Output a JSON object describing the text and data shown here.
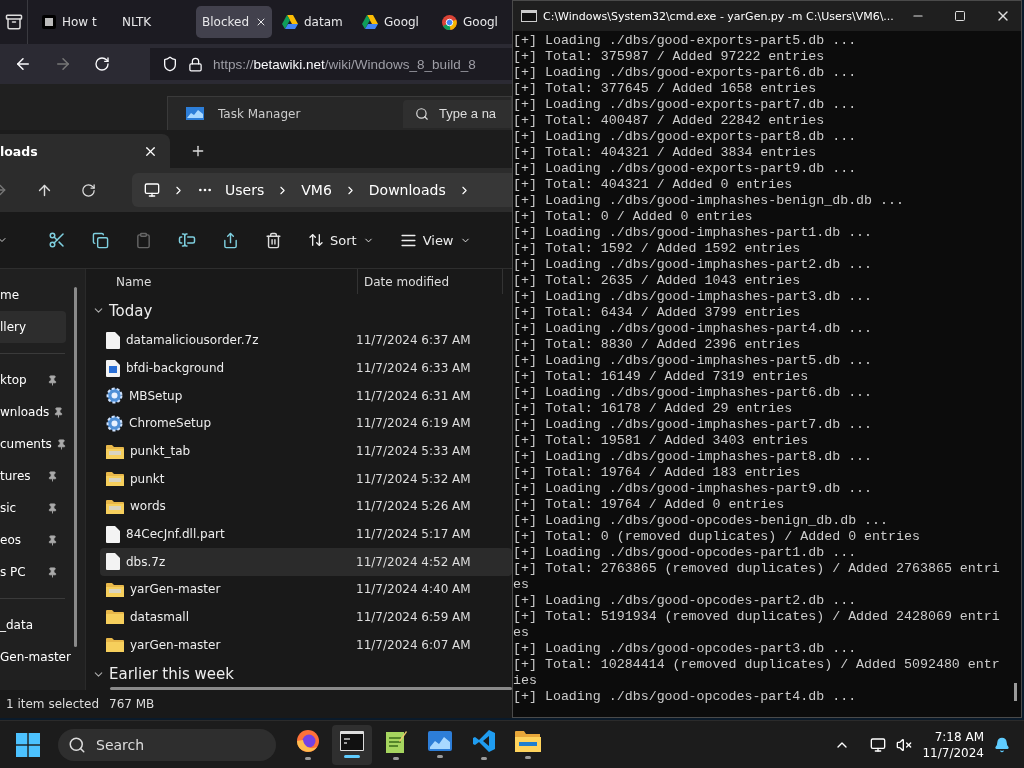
{
  "browser": {
    "tabs": [
      {
        "label": "How t",
        "kind": "mono",
        "selected": false
      },
      {
        "label": "NLTK",
        "kind": "plain",
        "selected": false
      },
      {
        "label": "Blocked",
        "kind": "plain",
        "selected": true
      },
      {
        "label": "datam",
        "kind": "drive",
        "selected": false
      },
      {
        "label": "Googl",
        "kind": "drive",
        "selected": false
      },
      {
        "label": "Googl",
        "kind": "chrome",
        "selected": false
      }
    ],
    "url": {
      "scheme": "https://",
      "host": "betawiki.net",
      "path": "/wiki/Windows_8_build_8"
    },
    "page": {
      "app_title": "Task Manager",
      "placeholder": "Type a na"
    }
  },
  "explorer": {
    "tab": {
      "label": "loads"
    },
    "breadcrumb": [
      "Users",
      "VM6",
      "Downloads"
    ],
    "toolbar": {
      "sort": "Sort",
      "view": "View"
    },
    "sidebar": {
      "sections": [
        {
          "items": [
            {
              "label": "me",
              "selected": false,
              "pinned": false
            },
            {
              "label": "llery",
              "selected": true,
              "pinned": false
            }
          ]
        },
        {
          "items": [
            {
              "label": "ktop",
              "selected": false,
              "pinned": true
            },
            {
              "label": "wnloads",
              "selected": false,
              "pinned": true
            },
            {
              "label": "cuments",
              "selected": false,
              "pinned": true
            },
            {
              "label": "tures",
              "selected": false,
              "pinned": true
            },
            {
              "label": "sic",
              "selected": false,
              "pinned": true
            },
            {
              "label": "eos",
              "selected": false,
              "pinned": true
            },
            {
              "label": "s PC",
              "selected": false,
              "pinned": true
            }
          ]
        },
        {
          "items": [
            {
              "label": "_data",
              "selected": false,
              "pinned": false
            },
            {
              "label": "Gen-master",
              "selected": false,
              "pinned": false
            }
          ]
        }
      ]
    },
    "columns": [
      "Name",
      "Date modified"
    ],
    "groups": [
      {
        "label": "Today",
        "expanded": true,
        "rows": [
          {
            "name": "datamaliciousorder.7z",
            "date": "11/7/2024 6:37 AM",
            "kind": "file",
            "selected": false
          },
          {
            "name": "bfdi-background",
            "date": "11/7/2024 6:33 AM",
            "kind": "image",
            "selected": false
          },
          {
            "name": "MBSetup",
            "date": "11/7/2024 6:31 AM",
            "kind": "installer",
            "selected": false
          },
          {
            "name": "ChromeSetup",
            "date": "11/7/2024 6:19 AM",
            "kind": "installer",
            "selected": false
          },
          {
            "name": "punkt_tab",
            "date": "11/7/2024 5:33 AM",
            "kind": "zip",
            "selected": false
          },
          {
            "name": "punkt",
            "date": "11/7/2024 5:32 AM",
            "kind": "zip",
            "selected": false
          },
          {
            "name": "words",
            "date": "11/7/2024 5:26 AM",
            "kind": "zip",
            "selected": false
          },
          {
            "name": "84CecJnf.dll.part",
            "date": "11/7/2024 5:17 AM",
            "kind": "file",
            "selected": false
          },
          {
            "name": "dbs.7z",
            "date": "11/7/2024 4:52 AM",
            "kind": "file",
            "selected": true
          },
          {
            "name": "yarGen-master",
            "date": "11/7/2024 4:40 AM",
            "kind": "zip",
            "selected": false
          },
          {
            "name": "datasmall",
            "date": "11/7/2024 6:59 AM",
            "kind": "folder",
            "selected": false
          },
          {
            "name": "yarGen-master",
            "date": "11/7/2024 6:07 AM",
            "kind": "folder",
            "selected": false
          }
        ]
      },
      {
        "label": "Earlier this week",
        "expanded": true
      }
    ],
    "status": {
      "selection": "1 item selected",
      "size": "767 MB"
    }
  },
  "console": {
    "title": "C:\\Windows\\System32\\cmd.exe - yarGen.py  -m C:\\Users\\VM6\\...",
    "lines": [
      "[+] Loading ./dbs/good-exports-part5.db ...",
      "[+] Total: 375987 / Added 97222 entries",
      "[+] Loading ./dbs/good-exports-part6.db ...",
      "[+] Total: 377645 / Added 1658 entries",
      "[+] Loading ./dbs/good-exports-part7.db ...",
      "[+] Total: 400487 / Added 22842 entries",
      "[+] Loading ./dbs/good-exports-part8.db ...",
      "[+] Total: 404321 / Added 3834 entries",
      "[+] Loading ./dbs/good-exports-part9.db ...",
      "[+] Total: 404321 / Added 0 entries",
      "[+] Loading ./dbs/good-imphashes-benign_db.db ...",
      "[+] Total: 0 / Added 0 entries",
      "[+] Loading ./dbs/good-imphashes-part1.db ...",
      "[+] Total: 1592 / Added 1592 entries",
      "[+] Loading ./dbs/good-imphashes-part2.db ...",
      "[+] Total: 2635 / Added 1043 entries",
      "[+] Loading ./dbs/good-imphashes-part3.db ...",
      "[+] Total: 6434 / Added 3799 entries",
      "[+] Loading ./dbs/good-imphashes-part4.db ...",
      "[+] Total: 8830 / Added 2396 entries",
      "[+] Loading ./dbs/good-imphashes-part5.db ...",
      "[+] Total: 16149 / Added 7319 entries",
      "[+] Loading ./dbs/good-imphashes-part6.db ...",
      "[+] Total: 16178 / Added 29 entries",
      "[+] Loading ./dbs/good-imphashes-part7.db ...",
      "[+] Total: 19581 / Added 3403 entries",
      "[+] Loading ./dbs/good-imphashes-part8.db ...",
      "[+] Total: 19764 / Added 183 entries",
      "[+] Loading ./dbs/good-imphashes-part9.db ...",
      "[+] Total: 19764 / Added 0 entries",
      "[+] Loading ./dbs/good-opcodes-benign_db.db ...",
      "[+] Total: 0 (removed duplicates) / Added 0 entries",
      "[+] Loading ./dbs/good-opcodes-part1.db ...",
      "[+] Total: 2763865 (removed duplicates) / Added 2763865 entri",
      "es",
      "[+] Loading ./dbs/good-opcodes-part2.db ...",
      "[+] Total: 5191934 (removed duplicates) / Added 2428069 entri",
      "es",
      "[+] Loading ./dbs/good-opcodes-part3.db ...",
      "[+] Total: 10284414 (removed duplicates) / Added 5092480 entr",
      "ies",
      "[+] Loading ./dbs/good-opcodes-part4.db ..."
    ]
  },
  "taskbar": {
    "search_label": "Search",
    "apps": [
      {
        "kind": "firefox",
        "active": false
      },
      {
        "kind": "terminal",
        "active": true
      },
      {
        "kind": "notepad",
        "active": false
      },
      {
        "kind": "taskmanager",
        "active": false
      },
      {
        "kind": "vscode",
        "active": false
      },
      {
        "kind": "explorer",
        "active": false
      }
    ],
    "time": "7:18 AM",
    "date": "11/7/2024"
  }
}
